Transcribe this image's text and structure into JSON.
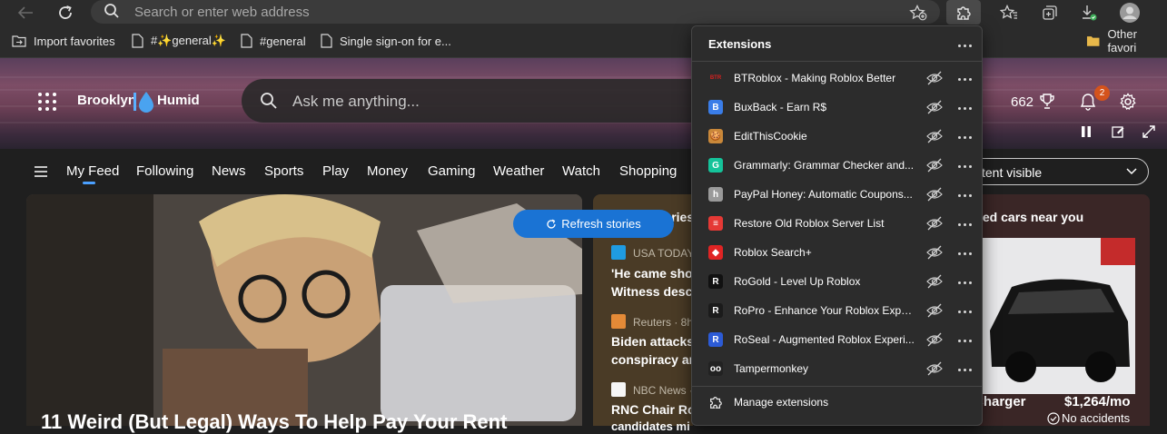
{
  "browser": {
    "address_placeholder": "Search or enter web address"
  },
  "favorites": [
    {
      "label": "Import favorites",
      "icon": "folder-import-icon"
    },
    {
      "label": "#✨general✨",
      "icon": "page-icon"
    },
    {
      "label": "#general",
      "icon": "page-icon"
    },
    {
      "label": "Single sign-on for e...",
      "icon": "page-icon"
    },
    {
      "label": "Other favori",
      "icon": "folder-icon"
    }
  ],
  "header": {
    "city": "Brooklyn",
    "condition": "Humid",
    "search_placeholder": "Ask me anything...",
    "rewards_points": "662",
    "notification_count": "2"
  },
  "nav": {
    "items": [
      "My Feed",
      "Following",
      "News",
      "Sports",
      "Play",
      "Money",
      "Gaming",
      "Weather",
      "Watch",
      "Shopping"
    ],
    "active": "My Feed",
    "content_visibility": "tent visible"
  },
  "feed": {
    "refresh_label": "Refresh stories",
    "hero_title": "11 Weird (But Legal) Ways To Help Pay Your Rent",
    "stories_label": "tories",
    "stories": [
      {
        "source": "USA TODAY",
        "headline_line1": "'He came shoo",
        "headline_line2": "Witness descr"
      },
      {
        "source": "Reuters · 8h",
        "headline_line1": "Biden attacks",
        "headline_line2": "conspiracy and"
      },
      {
        "source": "NBC News ·",
        "headline_line1": "RNC Chair Ron",
        "headline_line2": "candidates mi"
      }
    ],
    "cars": {
      "title": "led cars near you",
      "model": "Charger",
      "price": "$1,264/mo",
      "note": "No accidents"
    }
  },
  "extensions_panel": {
    "title": "Extensions",
    "items": [
      {
        "name": "BTRoblox - Making Roblox Better",
        "color": "#d8201f",
        "glyph": "BTR"
      },
      {
        "name": "BuxBack - Earn R$",
        "color": "#3a7de8",
        "glyph": "B"
      },
      {
        "name": "EditThisCookie",
        "color": "#c9883a",
        "glyph": "🍪"
      },
      {
        "name": "Grammarly: Grammar Checker and...",
        "color": "#15c39a",
        "glyph": "G"
      },
      {
        "name": "PayPal Honey: Automatic Coupons...",
        "color": "#9a9a9a",
        "glyph": "h"
      },
      {
        "name": "Restore Old Roblox Server List",
        "color": "#e53935",
        "glyph": "≡"
      },
      {
        "name": "Roblox Search+",
        "color": "#e02424",
        "glyph": "◆"
      },
      {
        "name": "RoGold - Level Up Roblox",
        "color": "#111111",
        "glyph": "R"
      },
      {
        "name": "RoPro - Enhance Your Roblox Expe...",
        "color": "#1b1b1b",
        "glyph": "R"
      },
      {
        "name": "RoSeal - Augmented Roblox Experi...",
        "color": "#2c5bd6",
        "glyph": "R"
      },
      {
        "name": "Tampermonkey",
        "color": "#222222",
        "glyph": "oo"
      }
    ],
    "manage_label": "Manage extensions"
  }
}
